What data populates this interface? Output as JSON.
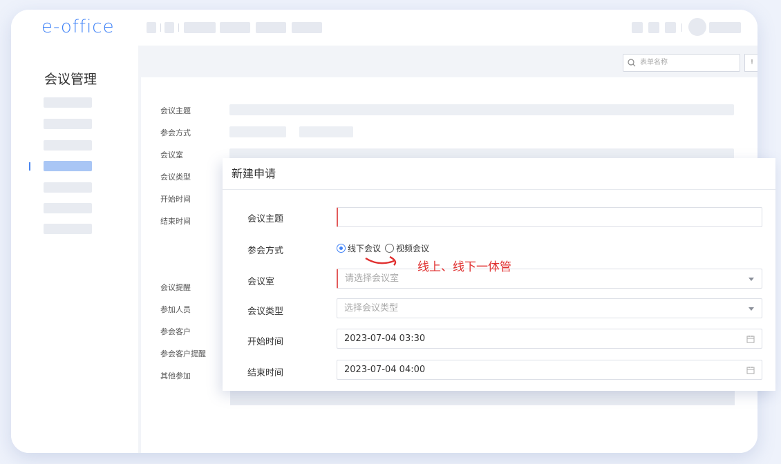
{
  "app": {
    "logo": "e-office"
  },
  "sidebar": {
    "title": "会议管理"
  },
  "search": {
    "placeholder": "表单名称"
  },
  "header_button_fragment": "!",
  "background_form": {
    "labels": [
      "会议主题",
      "参会方式",
      "会议室",
      "会议类型",
      "开始时间",
      "结束时间",
      "会议提醒",
      "参加人员",
      "参会客户",
      "参会客户提醒",
      "其他参加"
    ]
  },
  "modal": {
    "title": "新建申请",
    "fields": {
      "subject": {
        "label": "会议主题",
        "value": ""
      },
      "mode": {
        "label": "参会方式",
        "options": [
          {
            "label": "线下会议",
            "checked": true
          },
          {
            "label": "视频会议",
            "checked": false
          }
        ]
      },
      "room": {
        "label": "会议室",
        "placeholder": "请选择会议室"
      },
      "type": {
        "label": "会议类型",
        "placeholder": "选择会议类型"
      },
      "start": {
        "label": "开始时间",
        "value": "2023-07-04 03:30"
      },
      "end": {
        "label": "结束时间",
        "value": "2023-07-04 04:00"
      }
    }
  },
  "annotation": {
    "text": "线上、线下一体管",
    "color": "#e03030"
  },
  "colors": {
    "accent": "#3f82f7",
    "required": "#e25a5a"
  },
  "icons": {
    "search": "search-icon",
    "calendar": "calendar-icon",
    "dropdown": "chevron-down-icon"
  }
}
